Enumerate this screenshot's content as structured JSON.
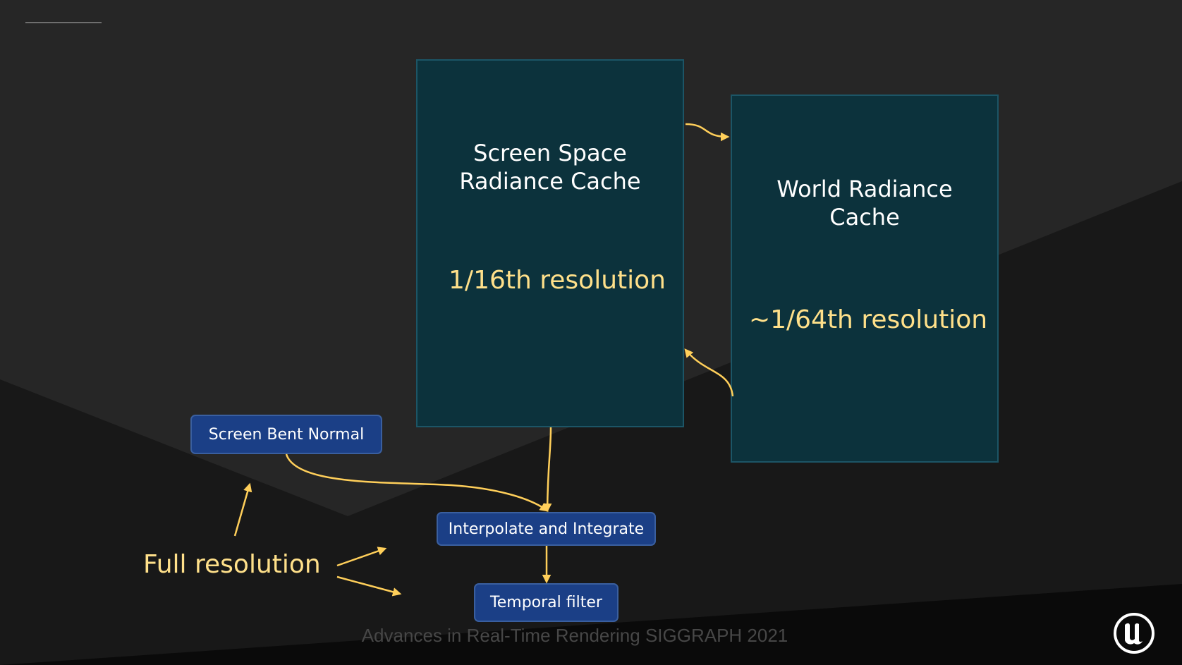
{
  "boxes": {
    "screen_space": {
      "title_line1": "Screen Space",
      "title_line2": "Radiance Cache",
      "resolution": "1/16th resolution"
    },
    "world": {
      "title_line1": "World Radiance",
      "title_line2": "Cache",
      "resolution": "~1/64th resolution"
    }
  },
  "nodes": {
    "screen_bent_normal": "Screen Bent Normal",
    "interpolate_integrate": "Interpolate and Integrate",
    "temporal_filter": "Temporal filter"
  },
  "full_resolution_label": "Full resolution",
  "footer": "Advances in Real-Time Rendering SIGGRAPH 2021",
  "logo_icon": "unreal-engine-logo-icon",
  "colors": {
    "background": "#262626",
    "cache_box": "#0c323c",
    "node": "#1b3f86",
    "accent": "#ffe08a"
  }
}
